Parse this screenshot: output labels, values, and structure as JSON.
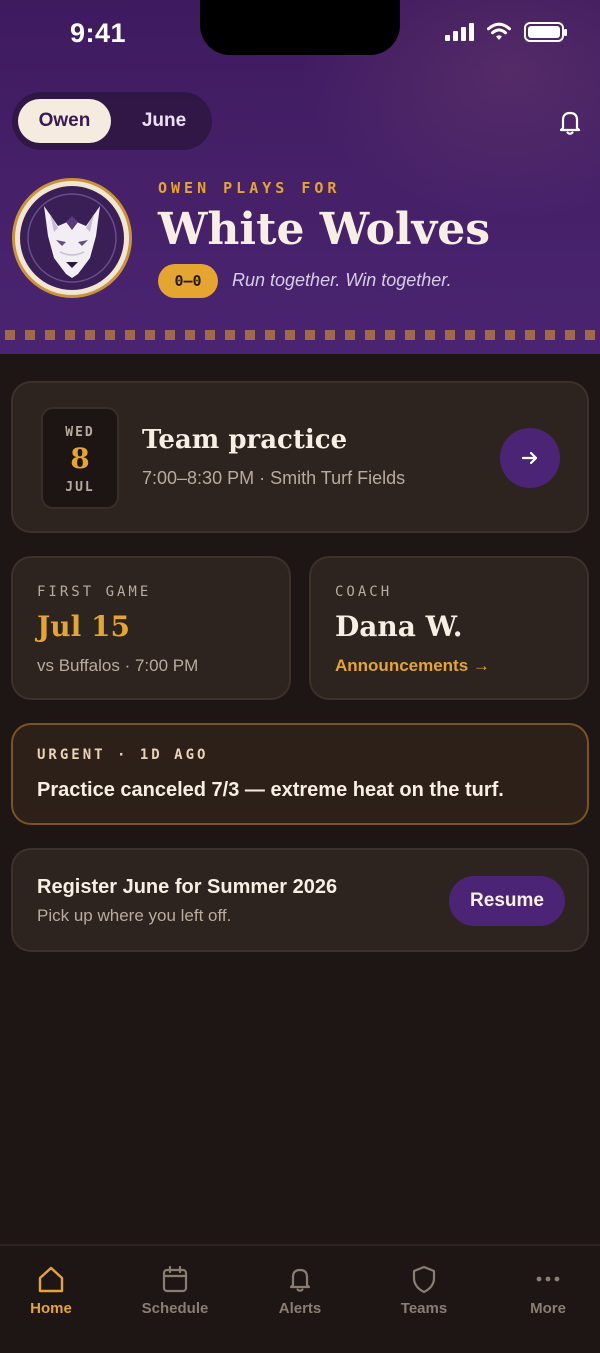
{
  "status_bar": {
    "time": "9:41"
  },
  "switcher": {
    "active": "Owen",
    "inactive": "June"
  },
  "team": {
    "plays_for": "OWEN PLAYS FOR",
    "name": "White Wolves",
    "record": "0–0",
    "tagline": "Run together. Win together."
  },
  "next_event": {
    "dow": "WED",
    "day": "8",
    "month": "JUL",
    "title": "Team practice",
    "details": "7:00–8:30 PM · Smith Turf Fields"
  },
  "first_game": {
    "label": "FIRST GAME",
    "date": "Jul 15",
    "details": "vs Buffalos · 7:00 PM"
  },
  "coach": {
    "label": "COACH",
    "name": "Dana W.",
    "link": "Announcements →"
  },
  "urgent": {
    "label": "URGENT · 1D AGO",
    "message": "Practice canceled 7/3 — extreme heat on the turf."
  },
  "register": {
    "title": "Register June for Summer 2026",
    "subtitle": "Pick up where you left off.",
    "button": "Resume"
  },
  "tabs": [
    {
      "label": "Home",
      "icon": "home-icon",
      "active": true
    },
    {
      "label": "Schedule",
      "icon": "calendar-icon",
      "active": false
    },
    {
      "label": "Alerts",
      "icon": "bell-icon",
      "active": false
    },
    {
      "label": "Teams",
      "icon": "shield-icon",
      "active": false
    },
    {
      "label": "More",
      "icon": "more-icon",
      "active": false
    }
  ],
  "colors": {
    "accent_gold": "#e5a531",
    "brand_purple": "#4b2476",
    "background": "#1e1614",
    "card": "#2d231f"
  }
}
